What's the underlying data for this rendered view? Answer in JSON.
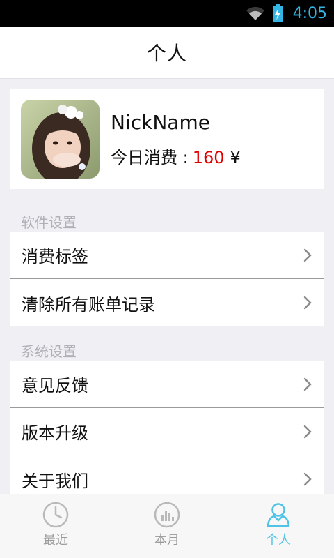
{
  "status_bar": {
    "time": "4:05",
    "icons": [
      "wifi-icon",
      "battery-charging-icon"
    ]
  },
  "header": {
    "title": "个人"
  },
  "profile": {
    "nickname": "NickName",
    "today_label": "今日消费 :",
    "today_amount": "160",
    "currency": "¥"
  },
  "software_settings": {
    "header": "软件设置",
    "items": [
      {
        "label": "消费标签"
      },
      {
        "label": "清除所有账单记录"
      }
    ]
  },
  "system_settings": {
    "header": "系统设置",
    "items": [
      {
        "label": "意见反馈"
      },
      {
        "label": "版本升级"
      },
      {
        "label": "关于我们"
      }
    ]
  },
  "tabs": [
    {
      "label": "最近",
      "icon": "clock-icon",
      "active": false
    },
    {
      "label": "本月",
      "icon": "bar-chart-icon",
      "active": false
    },
    {
      "label": "个人",
      "icon": "person-icon",
      "active": true
    }
  ],
  "colors": {
    "accent": "#4fc3e7",
    "amount": "#e00000",
    "background": "#efeff4"
  }
}
